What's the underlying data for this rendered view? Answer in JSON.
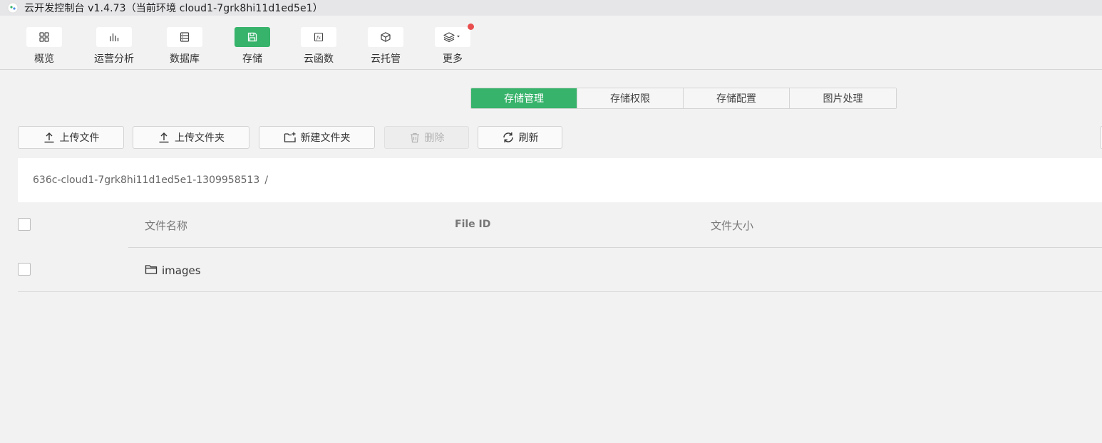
{
  "window": {
    "title": "云开发控制台 v1.4.73（当前环境 cloud1-7grk8hi11d1ed5e1）"
  },
  "toolbar": {
    "items": [
      {
        "label": "概览",
        "icon": "grid-icon"
      },
      {
        "label": "运营分析",
        "icon": "bar-chart-icon"
      },
      {
        "label": "数据库",
        "icon": "database-icon"
      },
      {
        "label": "存储",
        "icon": "save-icon",
        "active": true
      },
      {
        "label": "云函数",
        "icon": "function-icon"
      },
      {
        "label": "云托管",
        "icon": "cube-icon"
      },
      {
        "label": "更多",
        "icon": "layers-icon",
        "badge": true
      }
    ]
  },
  "tabs": [
    {
      "label": "存储管理",
      "active": true
    },
    {
      "label": "存储权限"
    },
    {
      "label": "存储配置"
    },
    {
      "label": "图片处理"
    }
  ],
  "actions": {
    "upload_file": "上传文件",
    "upload_folder": "上传文件夹",
    "new_folder": "新建文件夹",
    "delete": "删除",
    "refresh": "刷新"
  },
  "breadcrumb": {
    "bucket": "636c-cloud1-7grk8hi11d1ed5e1-1309958513",
    "separator": "/"
  },
  "table": {
    "columns": [
      "文件名称",
      "File ID",
      "文件大小"
    ],
    "rows": [
      {
        "name": "images",
        "type": "folder",
        "file_id": "",
        "size": ""
      }
    ]
  },
  "colors": {
    "accent": "#37b36b",
    "badge": "#e94e4e",
    "background": "#f2f2f2"
  }
}
